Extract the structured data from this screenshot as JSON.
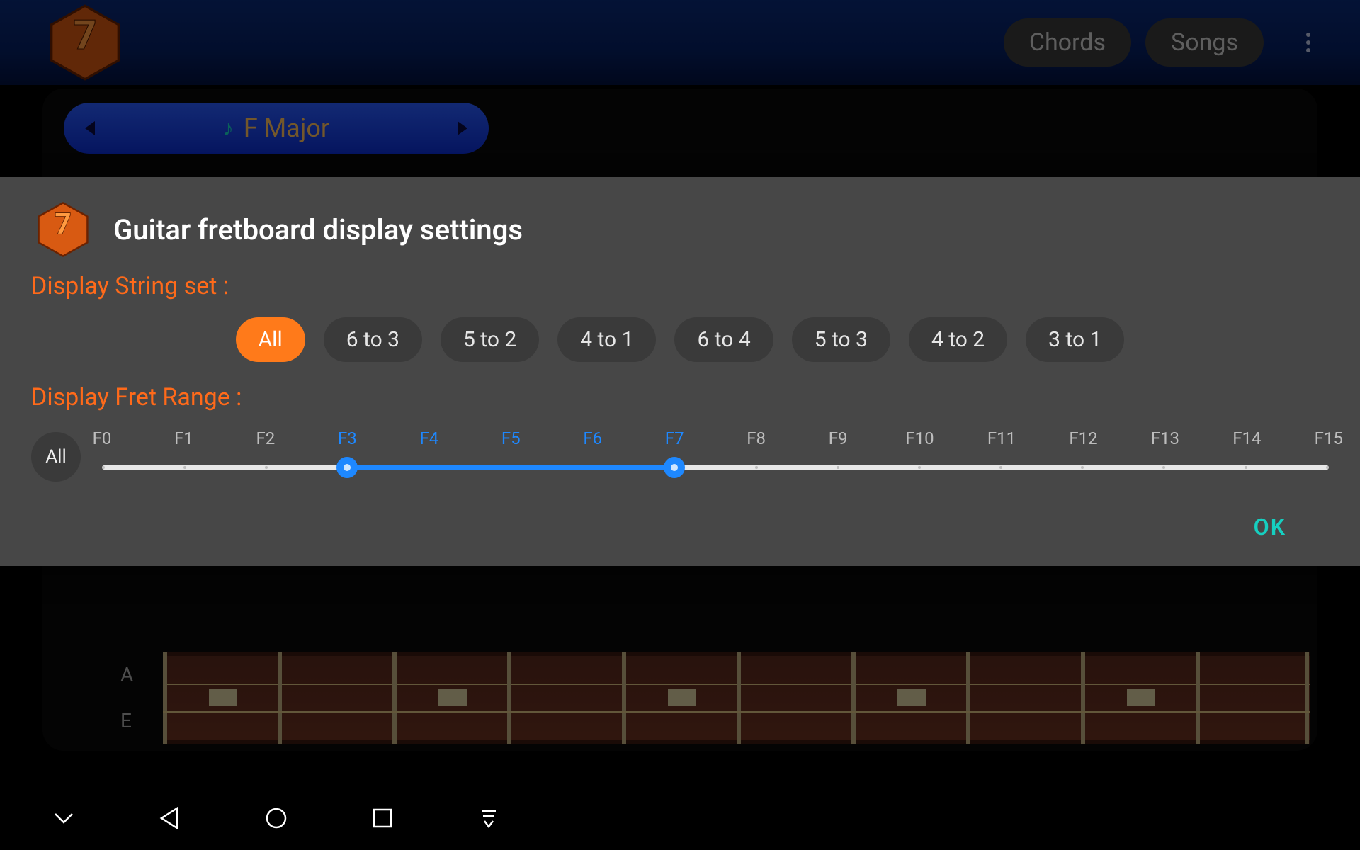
{
  "header": {
    "tabs": {
      "chords": "Chords",
      "songs": "Songs"
    }
  },
  "chord_selector": {
    "label": "F Major"
  },
  "fretboard": {
    "visible_strings": [
      "A",
      "E"
    ]
  },
  "dialog": {
    "title": "Guitar fretboard display settings",
    "string_set": {
      "label": "Display String set :",
      "options": [
        "All",
        "6 to 3",
        "5 to 2",
        "4 to 1",
        "6 to 4",
        "5 to 3",
        "4 to 2",
        "3 to 1"
      ],
      "selected_index": 0
    },
    "fret_range": {
      "label": "Display Fret Range :",
      "all_label": "All",
      "ticks": [
        "F0",
        "F1",
        "F2",
        "F3",
        "F4",
        "F5",
        "F6",
        "F7",
        "F8",
        "F9",
        "F10",
        "F11",
        "F12",
        "F13",
        "F14",
        "F15"
      ],
      "min_index": 3,
      "max_index": 7
    },
    "actions": {
      "ok": "OK"
    }
  },
  "colors": {
    "accent": "#ff7a1a",
    "accent_text": "#ff6a1a",
    "slider": "#1e88ff",
    "ok": "#16cfc0"
  }
}
